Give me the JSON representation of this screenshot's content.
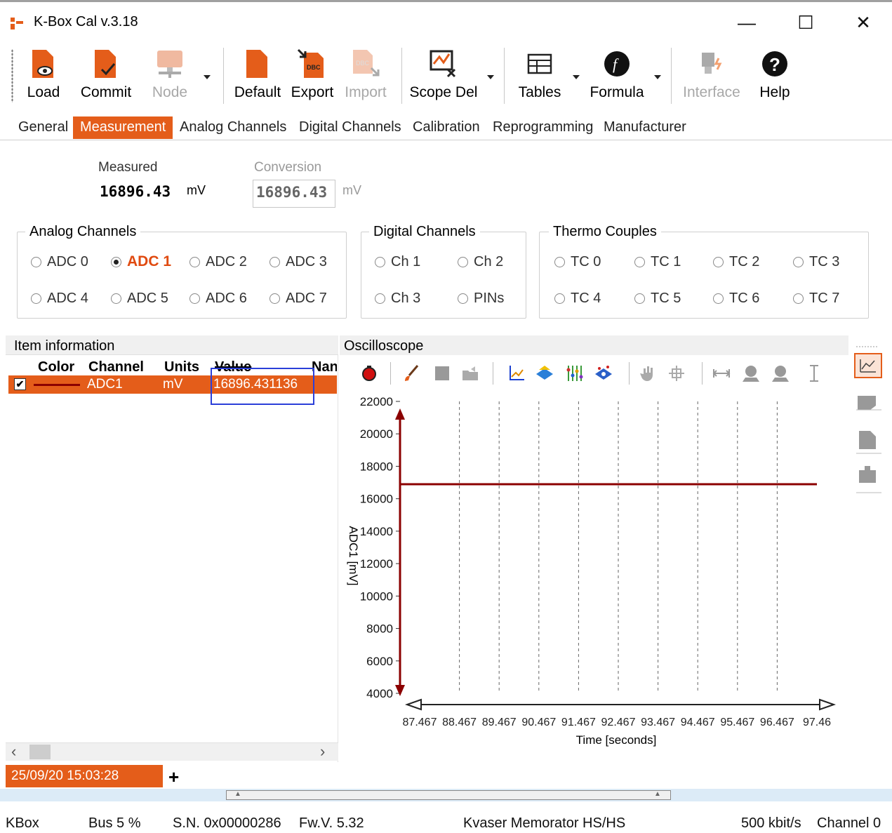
{
  "window": {
    "title": "K-Box Cal v.3.18",
    "controls": {
      "minimize": "—",
      "maximize": "☐",
      "close": "✕"
    }
  },
  "toolbar": {
    "load": "Load",
    "commit": "Commit",
    "node": "Node",
    "default": "Default",
    "export": "Export",
    "import": "Import",
    "scope_del": "Scope Del",
    "tables": "Tables",
    "formula": "Formula",
    "interface": "Interface",
    "help": "Help"
  },
  "tabs": [
    "General",
    "Measurement",
    "Analog Channels",
    "Digital Channels",
    "Calibration",
    "Reprogramming",
    "Manufacturer"
  ],
  "active_tab": "Measurement",
  "measurement": {
    "measured_label": "Measured",
    "measured_value": "16896.43",
    "measured_unit": "mV",
    "conversion_label": "Conversion",
    "conversion_value": "16896.43",
    "conversion_unit": "mV"
  },
  "groups": {
    "analog": {
      "title": "Analog Channels",
      "items": [
        "ADC 0",
        "ADC 1",
        "ADC 2",
        "ADC 3",
        "ADC 4",
        "ADC 5",
        "ADC 6",
        "ADC 7"
      ],
      "selected": "ADC 1"
    },
    "digital": {
      "title": "Digital Channels",
      "items": [
        "Ch 1",
        "Ch 2",
        "Ch 3",
        "PINs"
      ]
    },
    "thermo": {
      "title": "Thermo Couples",
      "items": [
        "TC 0",
        "TC 1",
        "TC 2",
        "TC 3",
        "TC 4",
        "TC 5",
        "TC 6",
        "TC 7"
      ]
    }
  },
  "item_info": {
    "title": "Item information",
    "columns": [
      "Color",
      "Channel",
      "Units",
      "Value",
      "Nan"
    ],
    "row": {
      "checked": true,
      "channel": "ADC1",
      "units": "mV",
      "value": "16896.431136",
      "color": "#8b0000"
    }
  },
  "oscilloscope": {
    "title": "Oscilloscope"
  },
  "chart_data": {
    "type": "line",
    "xlabel": "Time [seconds]",
    "ylabel": "ADC1 [mV]",
    "x_ticks": [
      "87.467",
      "88.467",
      "89.467",
      "90.467",
      "91.467",
      "92.467",
      "93.467",
      "94.467",
      "95.467",
      "96.467",
      "97.46"
    ],
    "y_ticks": [
      4000,
      6000,
      8000,
      10000,
      12000,
      14000,
      16000,
      18000,
      20000,
      22000
    ],
    "ylim": [
      4000,
      22000
    ],
    "xlim": [
      87.467,
      97.46
    ],
    "grid": "vertical dashed",
    "series": [
      {
        "name": "ADC1",
        "color": "#8b0000",
        "x": [
          87.467,
          97.46
        ],
        "y": [
          16896.43,
          16896.43
        ]
      }
    ]
  },
  "log_tab": {
    "label": "25/09/20 15:03:28",
    "add": "+"
  },
  "status": {
    "device": "KBox",
    "bus": "Bus 5 %",
    "sn": "S.N. 0x00000286",
    "fw": "Fw.V. 5.32",
    "interface": "Kvaser Memorator HS/HS",
    "bitrate": "500 kbit/s",
    "channel": "Channel 0"
  },
  "colors": {
    "accent": "#e45d1a",
    "series": "#8b0000",
    "focus": "#2b3fd8"
  }
}
